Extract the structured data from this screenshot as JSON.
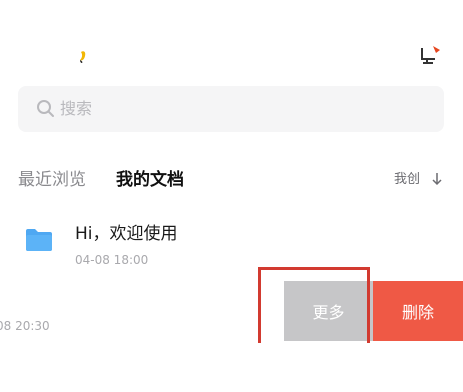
{
  "search": {
    "placeholder": "搜索"
  },
  "tabs": [
    {
      "label": "最近浏览",
      "active": false
    },
    {
      "label": "我的文档",
      "active": true
    }
  ],
  "sort": {
    "label": "我创"
  },
  "documents": [
    {
      "title": "Hi，欢迎使用",
      "date": "04-08 18:00"
    },
    {
      "title": "",
      "date": "08 20:30"
    }
  ],
  "swipe_actions": {
    "more_label": "更多",
    "delete_label": "删除"
  },
  "colors": {
    "accent_folder": "#4fa8f2",
    "delete": "#ef5945",
    "more": "#c6c6c8",
    "highlight": "#d23a30"
  }
}
